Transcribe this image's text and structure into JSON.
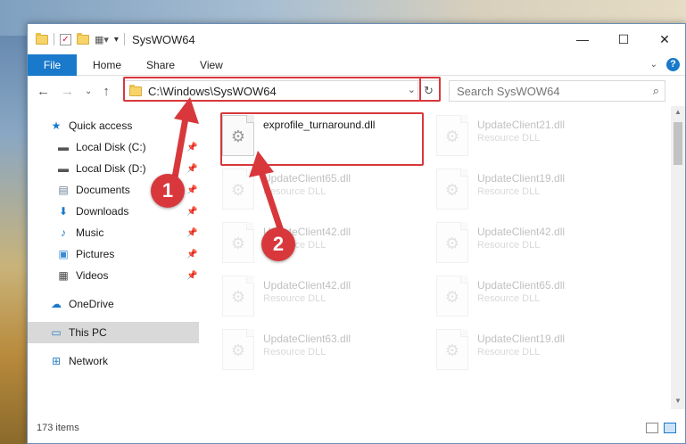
{
  "window": {
    "title": "SysWOW64",
    "controls": {
      "minimize": "—",
      "maximize": "☐",
      "close": "✕"
    }
  },
  "ribbon": {
    "tabs": [
      "File",
      "Home",
      "Share",
      "View"
    ],
    "expand_icon": "chevron-down-icon",
    "help": "?"
  },
  "nav": {
    "back": "←",
    "forward": "→",
    "recent": "⌄",
    "up": "↑",
    "address": "C:\\Windows\\SysWOW64",
    "refresh": "↻",
    "search_placeholder": "Search SysWOW64"
  },
  "sidebar": {
    "items": [
      {
        "label": "Quick access",
        "icon": "star-icon"
      },
      {
        "label": "Local Disk (C:)",
        "icon": "drive-icon",
        "pinned": true
      },
      {
        "label": "Local Disk (D:)",
        "icon": "drive-icon",
        "pinned": true
      },
      {
        "label": "Documents",
        "icon": "document-icon",
        "pinned": true
      },
      {
        "label": "Downloads",
        "icon": "download-icon",
        "pinned": true
      },
      {
        "label": "Music",
        "icon": "music-icon",
        "pinned": true
      },
      {
        "label": "Pictures",
        "icon": "pictures-icon",
        "pinned": true
      },
      {
        "label": "Videos",
        "icon": "videos-icon",
        "pinned": true
      },
      {
        "label": "OneDrive",
        "icon": "cloud-icon"
      },
      {
        "label": "This PC",
        "icon": "computer-icon",
        "selected": true
      },
      {
        "label": "Network",
        "icon": "network-icon"
      }
    ]
  },
  "files": [
    {
      "name": "exprofile_turnaround.dll",
      "type": ""
    },
    {
      "name": "UpdateClient21.dll",
      "type": "Resource DLL"
    },
    {
      "name": "UpdateClient65.dll",
      "type": "Resource DLL"
    },
    {
      "name": "UpdateClient19.dll",
      "type": "Resource DLL"
    },
    {
      "name": "UpdateClient42.dll",
      "type": "Resource DLL"
    },
    {
      "name": "UpdateClient42.dll",
      "type": "Resource DLL"
    },
    {
      "name": "UpdateClient42.dll",
      "type": "Resource DLL"
    },
    {
      "name": "UpdateClient65.dll",
      "type": "Resource DLL"
    },
    {
      "name": "UpdateClient63.dll",
      "type": "Resource DLL"
    },
    {
      "name": "UpdateClient19.dll",
      "type": "Resource DLL"
    }
  ],
  "status": {
    "count": "173 items"
  },
  "annotations": {
    "step1": "1",
    "step2": "2",
    "color": "#d8383c"
  }
}
